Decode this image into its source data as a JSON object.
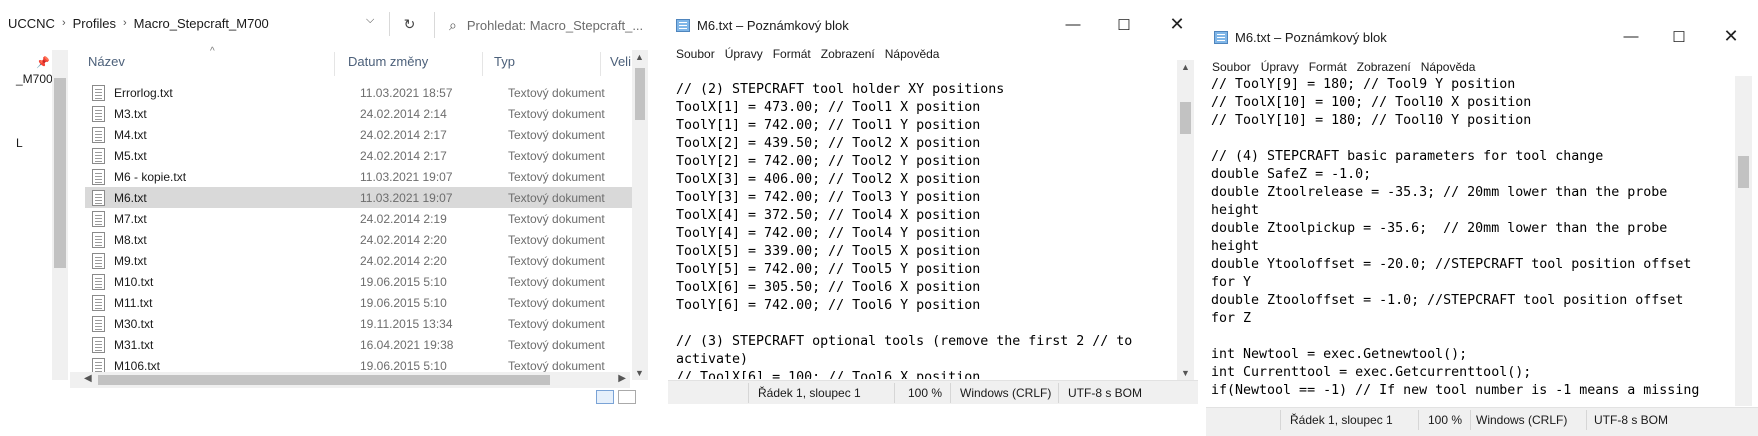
{
  "explorer": {
    "breadcrumb": [
      "UCCNC",
      "Profiles",
      "Macro_Stepcraft_M700"
    ],
    "search_placeholder": "Prohledat: Macro_Stepcraft_...",
    "nav_items": [
      "_M700",
      "L"
    ],
    "columns": {
      "name": "Název",
      "date": "Datum změny",
      "type": "Typ",
      "size": "Veli"
    },
    "files": [
      {
        "name": "Errorlog.txt",
        "date": "11.03.2021 18:57",
        "type": "Textový dokument"
      },
      {
        "name": "M3.txt",
        "date": "24.02.2014 2:14",
        "type": "Textový dokument"
      },
      {
        "name": "M4.txt",
        "date": "24.02.2014 2:17",
        "type": "Textový dokument"
      },
      {
        "name": "M5.txt",
        "date": "24.02.2014 2:17",
        "type": "Textový dokument"
      },
      {
        "name": "M6 - kopie.txt",
        "date": "11.03.2021 19:07",
        "type": "Textový dokument"
      },
      {
        "name": "M6.txt",
        "date": "11.03.2021 19:07",
        "type": "Textový dokument",
        "selected": true
      },
      {
        "name": "M7.txt",
        "date": "24.02.2014 2:19",
        "type": "Textový dokument"
      },
      {
        "name": "M8.txt",
        "date": "24.02.2014 2:20",
        "type": "Textový dokument"
      },
      {
        "name": "M9.txt",
        "date": "24.02.2014 2:20",
        "type": "Textový dokument"
      },
      {
        "name": "M10.txt",
        "date": "19.06.2015 5:10",
        "type": "Textový dokument"
      },
      {
        "name": "M11.txt",
        "date": "19.06.2015 5:10",
        "type": "Textový dokument"
      },
      {
        "name": "M30.txt",
        "date": "19.11.2015 13:34",
        "type": "Textový dokument"
      },
      {
        "name": "M31.txt",
        "date": "16.04.2021 19:38",
        "type": "Textový dokument"
      },
      {
        "name": "M106.txt",
        "date": "19.06.2015 5:10",
        "type": "Textový dokument"
      }
    ]
  },
  "notepad1": {
    "title": "M6.txt – Poznámkový blok",
    "menu": [
      "Soubor",
      "Úpravy",
      "Formát",
      "Zobrazení",
      "Nápověda"
    ],
    "lines": [
      "// (2) STEPCRAFT tool holder XY positions",
      "ToolX[1] = 473.00; // Tool1 X position",
      "ToolY[1] = 742.00; // Tool1 Y position",
      "ToolX[2] = 439.50; // Tool2 X position",
      "ToolY[2] = 742.00; // Tool2 Y position",
      "ToolX[3] = 406.00; // Tool2 X position",
      "ToolY[3] = 742.00; // Tool3 Y position",
      "ToolX[4] = 372.50; // Tool4 X position",
      "ToolY[4] = 742.00; // Tool4 Y position",
      "ToolX[5] = 339.00; // Tool5 X position",
      "ToolY[5] = 742.00; // Tool5 Y position",
      "ToolX[6] = 305.50; // Tool6 X position",
      "ToolY[6] = 742.00; // Tool6 Y position",
      "",
      "// (3) STEPCRAFT optional tools (remove the first 2 // to",
      "activate)",
      "// ToolX[6] = 100; // Tool6 X position"
    ],
    "status": {
      "position": "Řádek 1, sloupec 1",
      "zoom": "100 %",
      "eol": "Windows (CRLF)",
      "encoding": "UTF-8 s BOM"
    }
  },
  "notepad2": {
    "title": "M6.txt – Poznámkový blok",
    "menu": [
      "Soubor",
      "Úpravy",
      "Formát",
      "Zobrazení",
      "Nápověda"
    ],
    "lines": [
      "// ToolY[9] = 180; // Tool9 Y position",
      "// ToolX[10] = 100; // Tool10 X position",
      "// ToolY[10] = 180; // Tool10 Y position",
      "",
      "// (4) STEPCRAFT basic parameters for tool change",
      "double SafeZ = -1.0;",
      "double Ztoolrelease = -35.3; // 20mm lower than the probe",
      "height",
      "double Ztoolpickup = -35.6;  // 20mm lower than the probe",
      "height",
      "double Ytooloffset = -20.0; //STEPCRAFT tool position offset",
      "for Y",
      "double Ztooloffset = -1.0; //STEPCRAFT tool position offset",
      "for Z",
      "",
      "int Newtool = exec.Getnewtool();",
      "int Currenttool = exec.Getcurrenttool();",
      "if(Newtool == -1) // If new tool number is -1 means a missing"
    ],
    "status": {
      "position": "Řádek 1, sloupec 1",
      "zoom": "100 %",
      "eol": "Windows (CRLF)",
      "encoding": "UTF-8 s BOM"
    }
  }
}
